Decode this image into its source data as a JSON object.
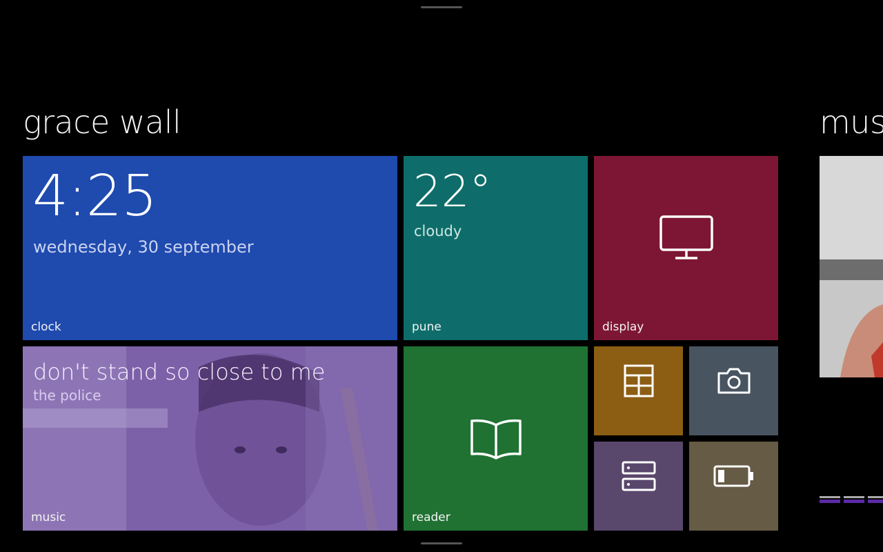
{
  "groups": [
    {
      "title": "grace wall"
    },
    {
      "title": "mus"
    }
  ],
  "tiles": {
    "clock": {
      "time": "4:25",
      "date": "wednesday, 30 september",
      "label": "clock",
      "color": "#1f4aae"
    },
    "weather": {
      "temperature": "22°",
      "condition": "cloudy",
      "label": "pune",
      "color": "#0e6d6a"
    },
    "display": {
      "label": "display",
      "icon": "monitor-icon",
      "color": "#7d1634"
    },
    "music": {
      "title": "don't stand so close to me",
      "artist": "the police",
      "label": "music",
      "color": "#7f5fa6"
    },
    "reader": {
      "label": "reader",
      "icon": "book-icon",
      "color": "#207233"
    },
    "layout": {
      "icon": "layout-grid-icon",
      "color": "#8c5e13"
    },
    "camera": {
      "icon": "camera-icon",
      "color": "#495461"
    },
    "storage": {
      "icon": "storage-icon",
      "color": "#5a476c"
    },
    "battery": {
      "icon": "battery-icon",
      "color": "#665b45"
    }
  }
}
